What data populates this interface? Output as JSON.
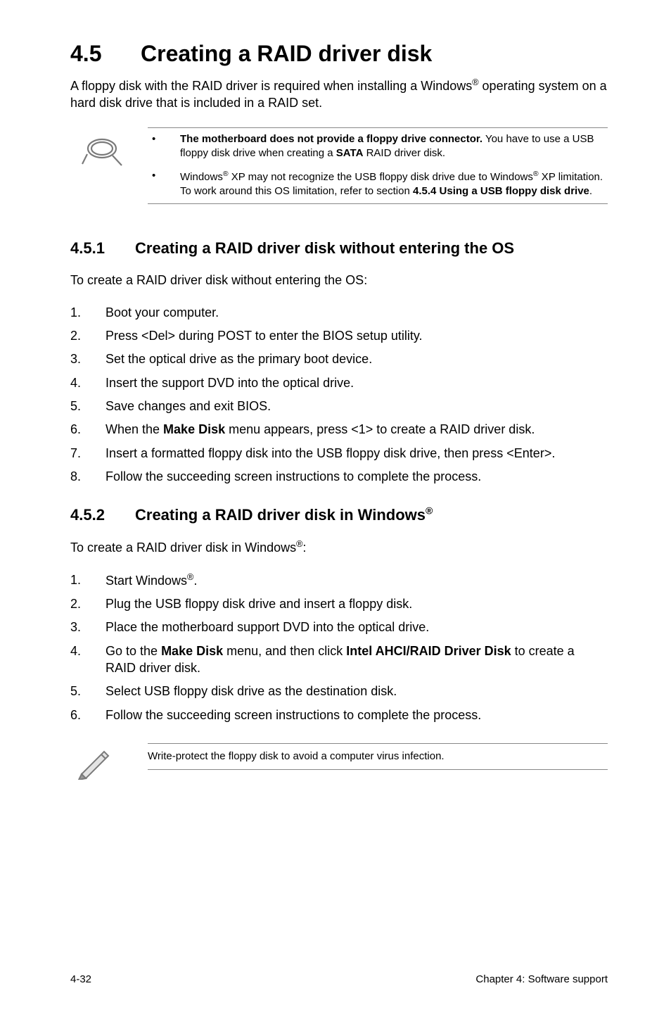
{
  "h1_num": "4.5",
  "h1_title": "Creating a RAID driver disk",
  "intro_html": "A floppy disk with the RAID driver is required when installing a Windows<sup>®</sup> operating system on a hard disk drive that is included in a RAID set.",
  "note1_items": [
    "<b>The motherboard does not provide a floppy drive connector.</b> You have to use a USB floppy disk drive when creating a <b>SATA</b> RAID driver disk.",
    "Windows<sup>®</sup> XP may not recognize the USB floppy disk drive due to Windows<sup>®</sup> XP limitation. To work around this OS limitation, refer to section <b>4.5.4 Using a USB floppy disk drive</b>."
  ],
  "sec1": {
    "num": "4.5.1",
    "title": "Creating a RAID driver disk without entering the OS",
    "lead": "To create a RAID driver disk without entering the OS:",
    "steps": [
      "Boot your computer.",
      "Press <Del> during POST to enter the BIOS setup utility.",
      "Set the optical drive as the primary boot device.",
      "Insert the support DVD into the optical drive.",
      "Save changes and exit BIOS.",
      "When the <b>Make Disk</b> menu appears, press <1> to create a RAID driver disk.",
      "Insert a formatted floppy disk into the USB floppy disk drive, then press <Enter>.",
      "Follow the succeeding screen instructions to complete the process."
    ]
  },
  "sec2": {
    "num": "4.5.2",
    "title_html": "Creating a RAID driver disk in Windows<sup>®</sup>",
    "lead_html": "To create a RAID driver disk in Windows<sup>®</sup>:",
    "steps": [
      "Start Windows<sup>®</sup>.",
      "Plug the USB floppy disk drive and insert a floppy disk.",
      "Place the motherboard support DVD into the optical drive.",
      "Go to the <b>Make Disk</b> menu, and then click <b>Intel AHCI/RAID Driver Disk</b> to create a RAID driver disk.",
      "Select USB floppy disk drive as the destination disk.",
      "Follow the succeeding screen instructions to complete the process."
    ]
  },
  "pencil_note": "Write-protect the floppy disk to avoid a computer virus infection.",
  "footer_left": "4-32",
  "footer_right": "Chapter 4: Software support"
}
